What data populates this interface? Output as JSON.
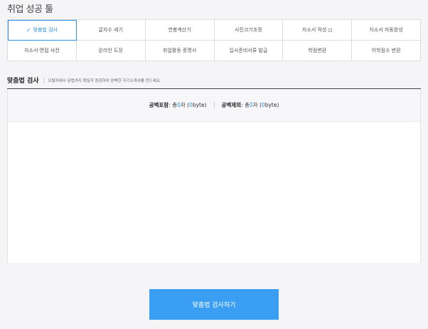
{
  "page_title": "취업 성공 툴",
  "tabs_row1": [
    {
      "label": "맞춤법 검사",
      "active": true
    },
    {
      "label": "글자수 세기"
    },
    {
      "label": "연봉계산기"
    },
    {
      "label": "사진크기조정"
    },
    {
      "label": "자소서 작성",
      "icon": "small-square-icon"
    },
    {
      "label": "자소서 자동완성"
    }
  ],
  "tabs_row2": [
    {
      "label": "자소서·면접 사전"
    },
    {
      "label": "온라인 도장"
    },
    {
      "label": "취업활동 증명서"
    },
    {
      "label": "입사준비서류 발급"
    },
    {
      "label": "학점변환"
    },
    {
      "label": "어학점수 변환"
    }
  ],
  "section": {
    "title": "맞춤법 검사",
    "description": "오탈자에서 문법까지 확실히 점검하여 완벽한 자기소개서를 만드세요."
  },
  "counter": {
    "with_space_label": "공백포함",
    "with_space_prefix": " : 총 ",
    "with_space_chars": "0",
    "with_space_mid": "자 (",
    "with_space_bytes": "0",
    "with_space_suffix": "byte)",
    "without_space_label": "공백제외",
    "without_space_prefix": " : 총 ",
    "without_space_chars": "0",
    "without_space_mid": "자 (",
    "without_space_bytes": "0",
    "without_space_suffix": "byte)"
  },
  "editor": {
    "placeholder": ""
  },
  "submit_label": "맞춤법 검사하기",
  "colors": {
    "accent": "#3a9ef2",
    "link": "#2a8fe0",
    "background": "#f5f5f7"
  }
}
